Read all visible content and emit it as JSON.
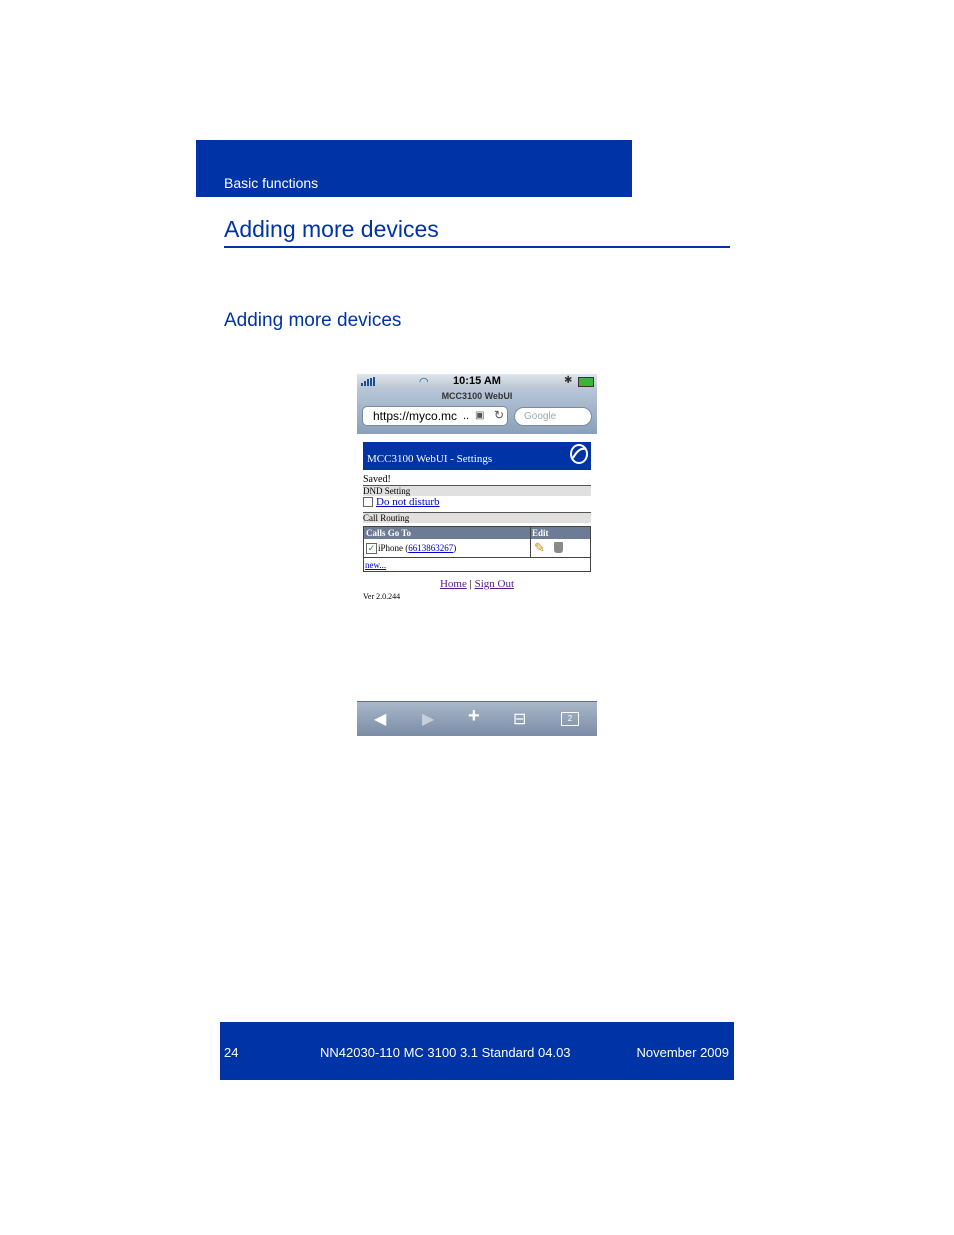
{
  "header": {
    "section": "Basic functions"
  },
  "page": {
    "title": "Adding more devices",
    "subtitle": "Adding more devices"
  },
  "phone": {
    "status": {
      "time": "10:15 AM"
    },
    "browser": {
      "title": "MCC3100 WebUI",
      "url": "https://myco.mc",
      "url_more": "..",
      "search_placeholder": "Google"
    },
    "webui": {
      "banner": "MCC3100 WebUI - Settings",
      "saved": "Saved!",
      "dnd_heading": "DND Setting",
      "dnd_label": "Do not disturb",
      "routing_heading": "Call Routing",
      "table": {
        "col1": "Calls Go To",
        "col2": "Edit",
        "row": {
          "device": "iPhone",
          "number": "6613863267"
        }
      },
      "new_link": "new...",
      "home": "Home",
      "separator": "|",
      "signout": "Sign Out",
      "version": "Ver 2.0.244"
    },
    "toolbar": {
      "tabs_count": "2"
    }
  },
  "footer": {
    "page_number": "24",
    "doc_id": "NN42030-110 MC 3100 3.1 Standard 04.03",
    "date": "November 2009"
  },
  "colors": {
    "brand": "#0033a6"
  }
}
